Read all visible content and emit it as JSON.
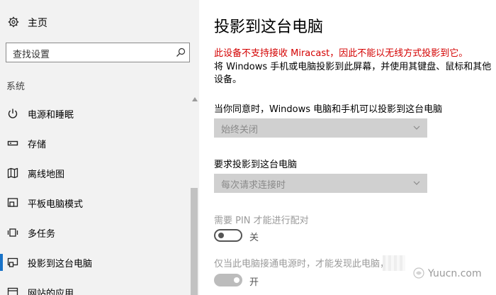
{
  "sidebar": {
    "home_label": "主页",
    "search_placeholder": "查找设置",
    "section_label": "系统",
    "items": [
      {
        "label": "电源和睡眠",
        "icon": "power-icon"
      },
      {
        "label": "存储",
        "icon": "storage-icon"
      },
      {
        "label": "离线地图",
        "icon": "map-icon"
      },
      {
        "label": "平板电脑模式",
        "icon": "tablet-mode-icon"
      },
      {
        "label": "多任务",
        "icon": "multitasking-icon"
      },
      {
        "label": "投影到这台电脑",
        "icon": "project-icon",
        "active": true
      },
      {
        "label": "网站的应用",
        "icon": "apps-for-websites-icon"
      }
    ]
  },
  "main": {
    "title": "投影到这台电脑",
    "warning": "此设备不支持接收 Miracast，因此不能以无线方式投影到它。",
    "description": "将 Windows 手机或电脑投影到此屏幕，并使用其键盘、鼠标和其他设备。",
    "setting1": {
      "label": "当你同意时，Windows 电脑和手机可以投影到这台电脑",
      "value": "始终关闭"
    },
    "setting2": {
      "label": "要求投影到这台电脑",
      "value": "每次请求连接时"
    },
    "setting3": {
      "label": "需要 PIN 才能进行配对",
      "toggle": "关"
    },
    "setting4": {
      "label": "仅当此电脑接通电源时，才能发现此电脑，才",
      "toggle": "开"
    }
  },
  "watermark": "Yuucn.com",
  "colors": {
    "accent": "#1a73c8",
    "warning": "#d40000",
    "sidebar_bg": "#f2f2f2"
  }
}
